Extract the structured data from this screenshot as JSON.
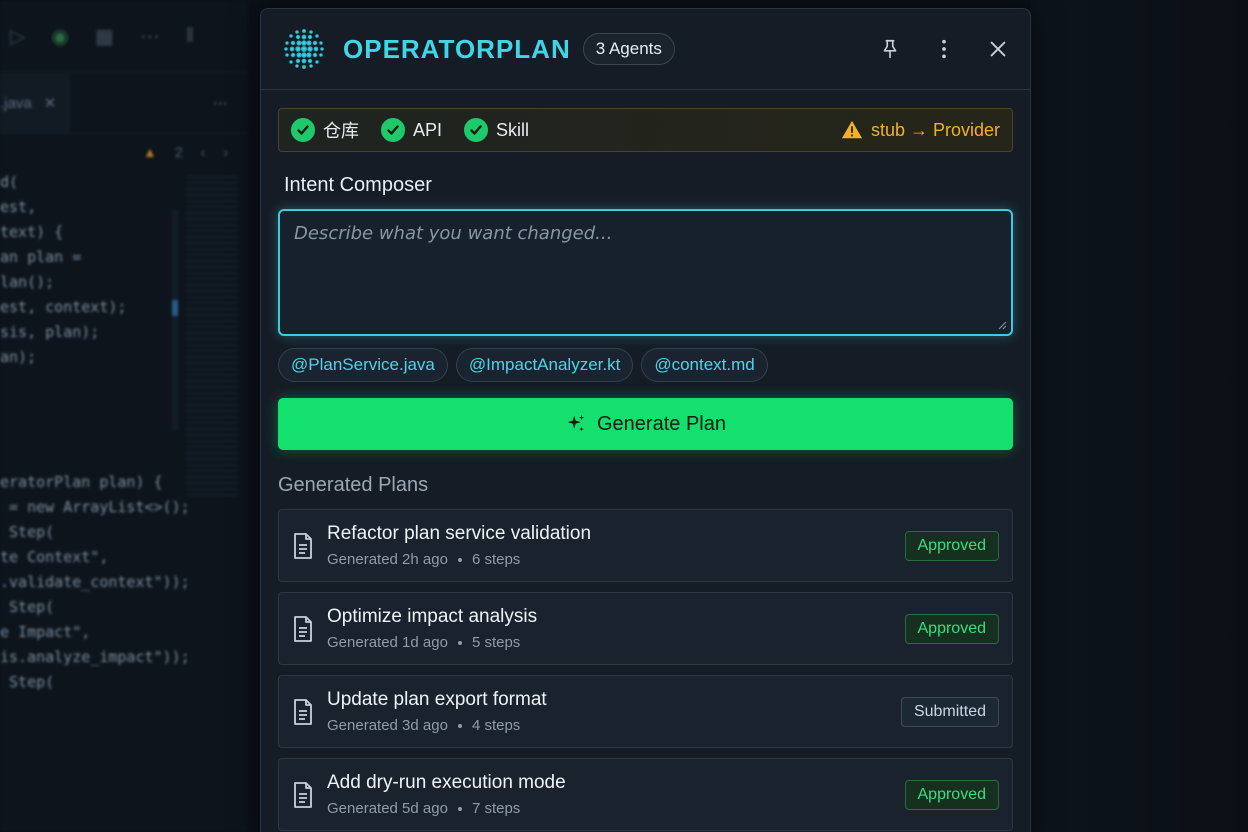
{
  "ide": {
    "tab_name": ".java",
    "warning_count": "2",
    "code_lines": [
      "d(",
      "est,",
      "text) {",
      "an plan =",
      "lan();",
      "est, context);",
      "sis, plan);",
      "an);",
      "",
      "",
      "",
      "",
      "eratorPlan plan) {",
      " = new ArrayList<>();",
      " Step(",
      "te Context\",",
      ".validate_context\"));",
      " Step(",
      "e Impact\",",
      "is.analyze_impact\"));",
      " Step("
    ]
  },
  "header": {
    "title": "OPERATORPLAN",
    "agents_badge": "3 Agents"
  },
  "status": {
    "items": [
      {
        "label": "仓库"
      },
      {
        "label": "API"
      },
      {
        "label": "Skill"
      }
    ],
    "warning": "stub → Provider",
    "colors": {
      "ok": "#1dc96b",
      "warn": "#f2b02a"
    }
  },
  "composer": {
    "label": "Intent Composer",
    "placeholder": "Describe what you want changed...",
    "value": "",
    "chips": [
      "@PlanService.java",
      "@ImpactAnalyzer.kt",
      "@context.md"
    ]
  },
  "generate": {
    "label": "Generate Plan",
    "icon": "sparkles-icon",
    "color": "#14e06e"
  },
  "plans": {
    "label": "Generated Plans",
    "items": [
      {
        "title": "Refactor plan service validation",
        "age": "Generated 2h ago",
        "steps": "6 steps",
        "status": "Approved"
      },
      {
        "title": "Optimize impact analysis",
        "age": "Generated 1d ago",
        "steps": "5 steps",
        "status": "Approved"
      },
      {
        "title": "Update plan export format",
        "age": "Generated 3d ago",
        "steps": "4 steps",
        "status": "Submitted"
      },
      {
        "title": "Add dry-run execution mode",
        "age": "Generated 5d ago",
        "steps": "7 steps",
        "status": "Approved"
      }
    ]
  }
}
